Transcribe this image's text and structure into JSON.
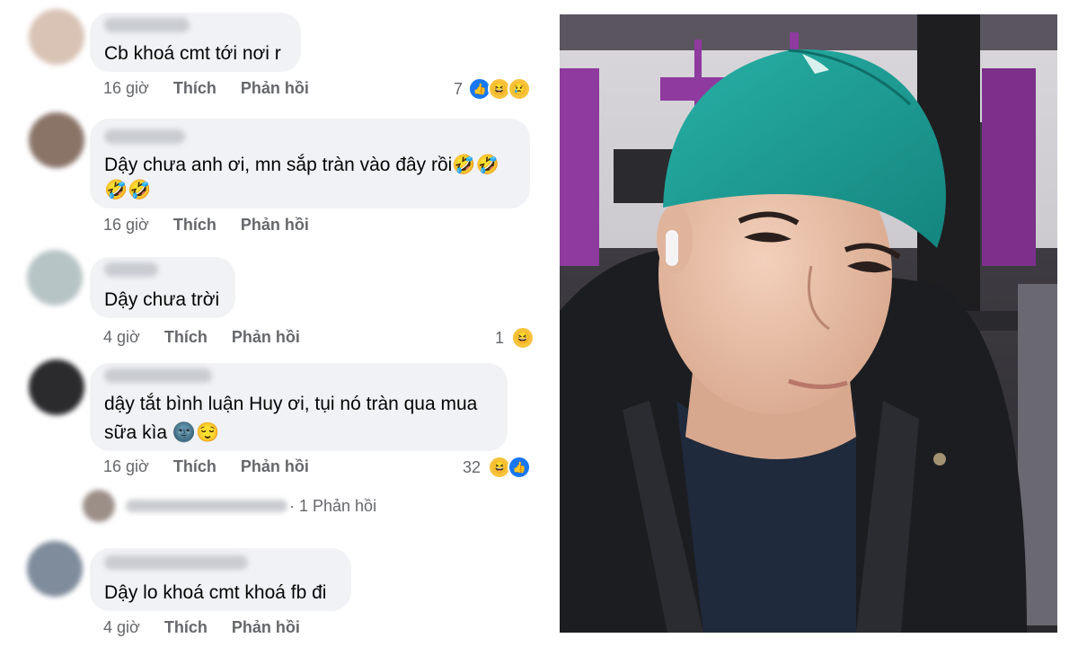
{
  "comments": [
    {
      "text_lines": [
        "Cb khoá cmt tới nơi r"
      ],
      "time": "16 giờ",
      "like": "Thích",
      "reply": "Phản hồi",
      "reaction_count": "7"
    },
    {
      "text_lines": [
        "Dậy chưa anh ơi, mn sắp tràn vào đây rồi🤣🤣",
        "🤣🤣"
      ],
      "time": "16 giờ",
      "like": "Thích",
      "reply": "Phản hồi",
      "reaction_count": ""
    },
    {
      "text_lines": [
        "Dậy chưa trời"
      ],
      "time": "4 giờ",
      "like": "Thích",
      "reply": "Phản hồi",
      "reaction_count": "1"
    },
    {
      "text_lines": [
        "dậy tắt bình luận Huy ơi, tụi nó tràn qua mua",
        "sữa kìa 🌚😌"
      ],
      "time": "16 giờ",
      "like": "Thích",
      "reply": "Phản hồi",
      "reaction_count": "32"
    },
    {
      "text_lines": [
        "Dậy lo khoá cmt khoá fb đi"
      ],
      "time": "4 giờ",
      "like": "Thích",
      "reply": "Phản hồi",
      "reaction_count": ""
    }
  ],
  "reply_link": "· 1 Phản hồi",
  "icons": {
    "like": "like-icon",
    "haha": "haha-icon",
    "sad": "sad-icon"
  },
  "colors": {
    "bubble": "#f0f2f5",
    "like_blue": "#1877f2",
    "cap": "#1f9e96",
    "gym_purple": "#8e3a9e"
  }
}
